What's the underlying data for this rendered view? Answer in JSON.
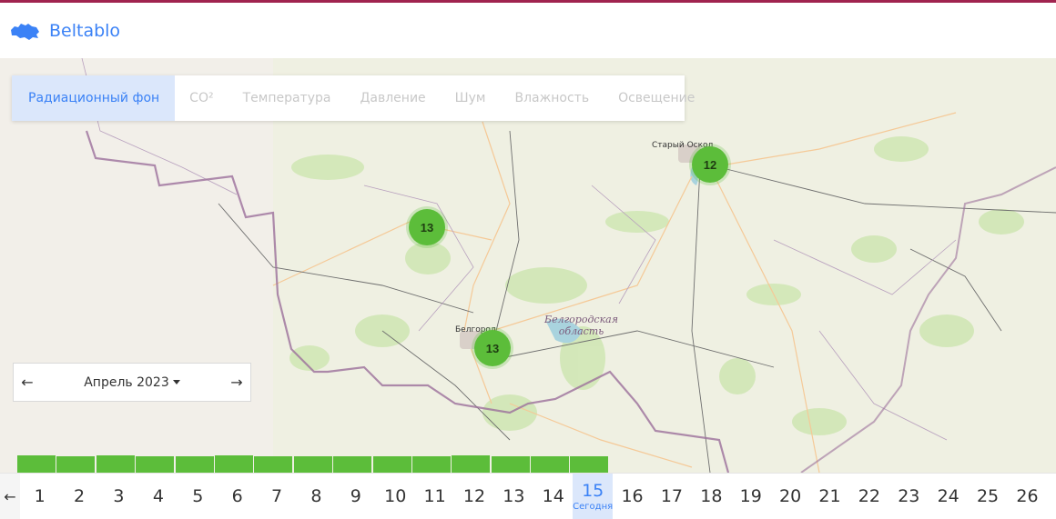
{
  "header": {
    "brand": "Beltablo",
    "logo_icon": "belgorod-region-map-icon",
    "accent": "#3b82f6",
    "top_line_color": "#a0234f"
  },
  "tabs": [
    {
      "label": "Радиационный фон",
      "active": true
    },
    {
      "label": "CO²",
      "active": false
    },
    {
      "label": "Температура",
      "active": false
    },
    {
      "label": "Давление",
      "active": false
    },
    {
      "label": "Шум",
      "active": false
    },
    {
      "label": "Влажность",
      "active": false
    },
    {
      "label": "Освещение",
      "active": false
    }
  ],
  "map": {
    "labels": {
      "stary_oskol": "Старый Оскол",
      "belgorod": "Белгород",
      "region": "Белгородская\nобласть"
    },
    "markers": [
      {
        "id": "stary-oskol",
        "value": "12"
      },
      {
        "id": "center",
        "value": "13"
      },
      {
        "id": "belgorod",
        "value": "13"
      }
    ],
    "marker_color": "#5cbd3a"
  },
  "month_picker": {
    "prev": "←",
    "label": "Апрель 2023",
    "next": "→"
  },
  "calendar": {
    "back": "←",
    "days": [
      "1",
      "2",
      "3",
      "4",
      "5",
      "6",
      "7",
      "8",
      "9",
      "10",
      "11",
      "12",
      "13",
      "14",
      "15",
      "16",
      "17",
      "18",
      "19",
      "20",
      "21",
      "22",
      "23",
      "24",
      "25",
      "26"
    ],
    "today": "15",
    "today_label": "Сегодня",
    "days_with_data": 15
  }
}
